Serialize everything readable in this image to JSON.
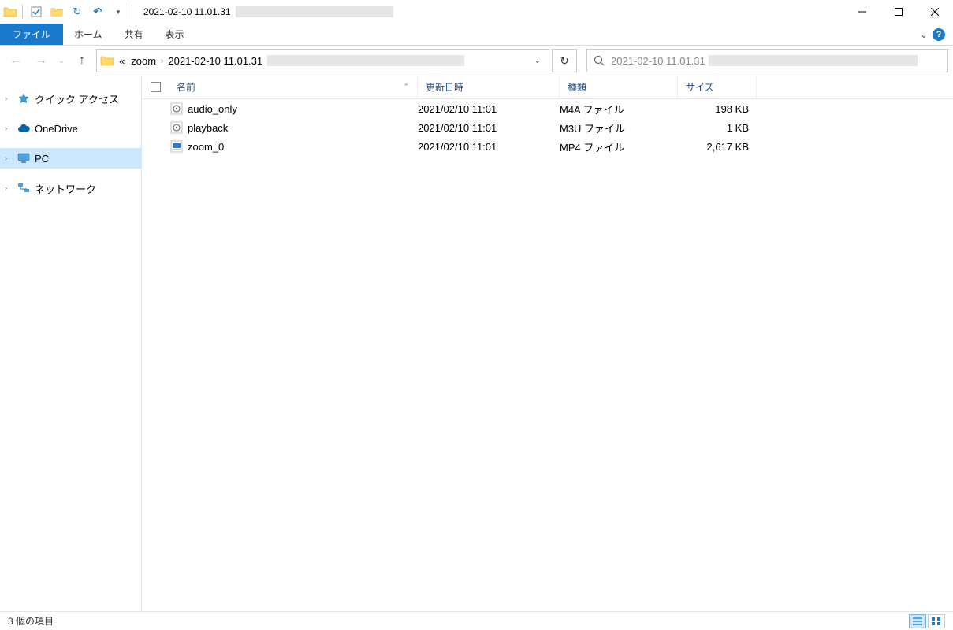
{
  "title": {
    "text": "2021-02-10 11.01.31"
  },
  "ribbon": {
    "file": "ファイル",
    "home": "ホーム",
    "share": "共有",
    "view": "表示"
  },
  "breadcrumb": {
    "prefix": "«",
    "seg1": "zoom",
    "seg2": "2021-02-10 11.01.31"
  },
  "search": {
    "placeholder": "2021-02-10 11.01.31"
  },
  "sidebar": {
    "quick": "クイック アクセス",
    "onedrive": "OneDrive",
    "pc": "PC",
    "network": "ネットワーク"
  },
  "columns": {
    "name": "名前",
    "date": "更新日時",
    "type": "種類",
    "size": "サイズ"
  },
  "files": [
    {
      "name": "audio_only",
      "date": "2021/02/10 11:01",
      "type": "M4A ファイル",
      "size": "198 KB",
      "icon": "media"
    },
    {
      "name": "playback",
      "date": "2021/02/10 11:01",
      "type": "M3U ファイル",
      "size": "1 KB",
      "icon": "media"
    },
    {
      "name": "zoom_0",
      "date": "2021/02/10 11:01",
      "type": "MP4 ファイル",
      "size": "2,617 KB",
      "icon": "video"
    }
  ],
  "status": {
    "count": "3 個の項目"
  }
}
